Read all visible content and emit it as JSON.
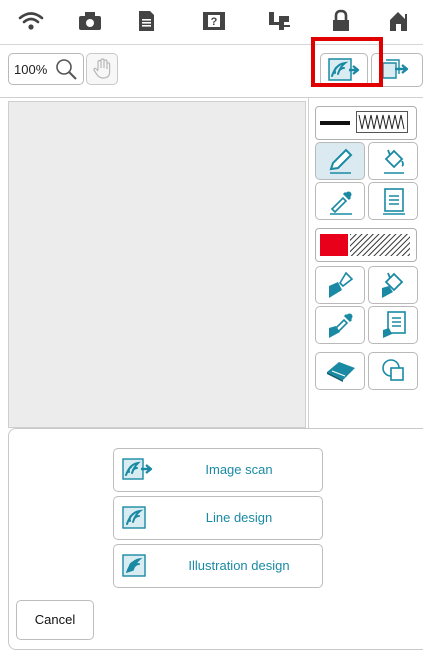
{
  "statusbar": {
    "icons": [
      "wifi-icon",
      "camera-icon",
      "document-icon",
      "help-icon",
      "sewing-machine-icon",
      "lock-icon",
      "home-icon"
    ]
  },
  "toolbar": {
    "zoom_label": "100%",
    "icons": [
      "magnifier-icon",
      "hand-icon",
      "image-import-icon",
      "export-icon"
    ]
  },
  "tools": {
    "line_sample_icon": "zigzag-line-icon",
    "fill_sample_icon": "hatch-pattern-icon",
    "accent_color": "#e8001a"
  },
  "import_menu": {
    "options": [
      {
        "label": "Image scan"
      },
      {
        "label": "Line design"
      },
      {
        "label": "Illustration design"
      }
    ],
    "cancel_label": "Cancel"
  },
  "colors": {
    "brand": "#1a8aa4",
    "highlight": "#e00000"
  }
}
